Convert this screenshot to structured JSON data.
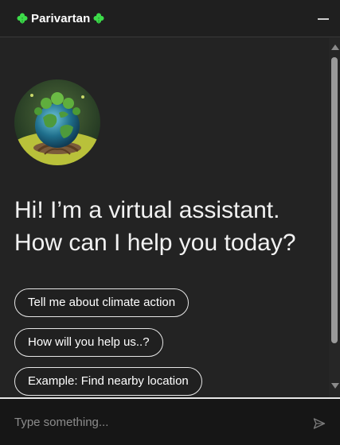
{
  "header": {
    "title": "Parivartan",
    "left_icon": "clover-icon",
    "right_icon": "clover-icon",
    "minimize_icon": "minimize-icon",
    "clover_color": "#3ddc4a"
  },
  "main": {
    "avatar_icon": "earth-tree-avatar",
    "greeting_line1": "Hi! I’m a virtual assistant.",
    "greeting_line2": "How can I help you today?",
    "suggestions": [
      "Tell me about climate action",
      "How will you help us..?",
      "Example: Find nearby location"
    ]
  },
  "composer": {
    "placeholder": "Type something...",
    "send_icon": "send-icon"
  }
}
